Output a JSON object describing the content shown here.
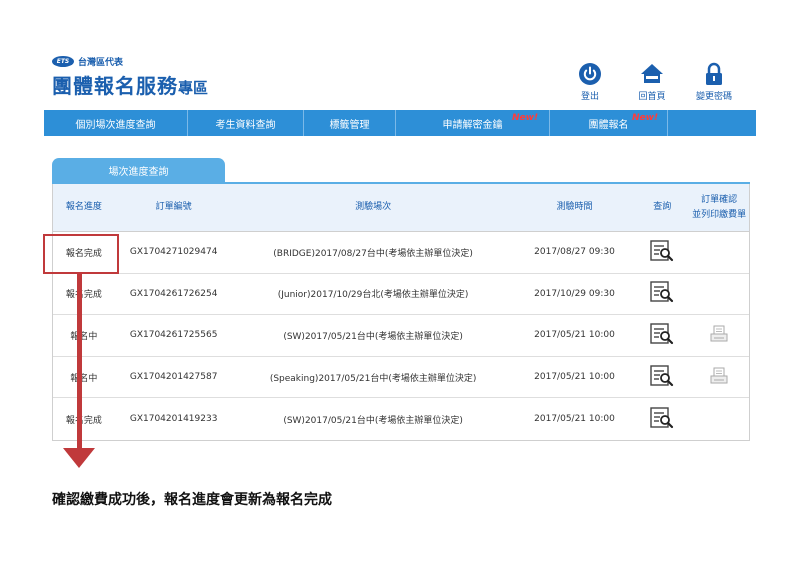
{
  "brand": {
    "badge": "ETS",
    "region": "台灣區代表",
    "title": "團體報名服務",
    "subtitle": "專區"
  },
  "top_links": [
    {
      "label": "登出",
      "icon": "power-icon"
    },
    {
      "label": "回首頁",
      "icon": "home-icon"
    },
    {
      "label": "變更密碼",
      "icon": "lock-icon"
    }
  ],
  "nav": [
    {
      "label": "個別場次進度查詢",
      "new": ""
    },
    {
      "label": "考生資料查詢",
      "new": ""
    },
    {
      "label": "標籤管理",
      "new": ""
    },
    {
      "label": "申請解密金鑰",
      "new": "New!"
    },
    {
      "label": "團體報名",
      "new": "New!"
    }
  ],
  "tab": {
    "label": "場次進度查詢"
  },
  "table": {
    "headers": {
      "status": "報名進度",
      "order_no": "訂單編號",
      "session": "測驗場次",
      "time": "測驗時間",
      "query": "查詢",
      "confirm_line1": "訂單確認",
      "confirm_line2": "並列印繳費單"
    },
    "rows": [
      {
        "status": "報名完成",
        "order_no": "GX1704271029474",
        "session": "(BRIDGE)2017/08/27台中(考場依主辦單位決定)",
        "time": "2017/08/27 09:30",
        "print": false
      },
      {
        "status": "報名完成",
        "order_no": "GX1704261726254",
        "session": "(Junior)2017/10/29台北(考場依主辦單位決定)",
        "time": "2017/10/29 09:30",
        "print": false
      },
      {
        "status": "報名中",
        "order_no": "GX1704261725565",
        "session": "(SW)2017/05/21台中(考場依主辦單位決定)",
        "time": "2017/05/21 10:00",
        "print": true
      },
      {
        "status": "報名中",
        "order_no": "GX1704201427587",
        "session": "(Speaking)2017/05/21台中(考場依主辦單位決定)",
        "time": "2017/05/21 10:00",
        "print": true
      },
      {
        "status": "報名完成",
        "order_no": "GX1704201419233",
        "session": "(SW)2017/05/21台中(考場依主辦單位決定)",
        "time": "2017/05/21 10:00",
        "print": false
      }
    ]
  },
  "caption": "確認繳費成功後，報名進度會更新為報名完成",
  "colors": {
    "brand_blue": "#1b5fae",
    "nav_blue": "#2d8fd7",
    "tab_blue": "#5aaee5",
    "highlight_red": "#c0393b",
    "new_red": "#ff3b3b"
  }
}
